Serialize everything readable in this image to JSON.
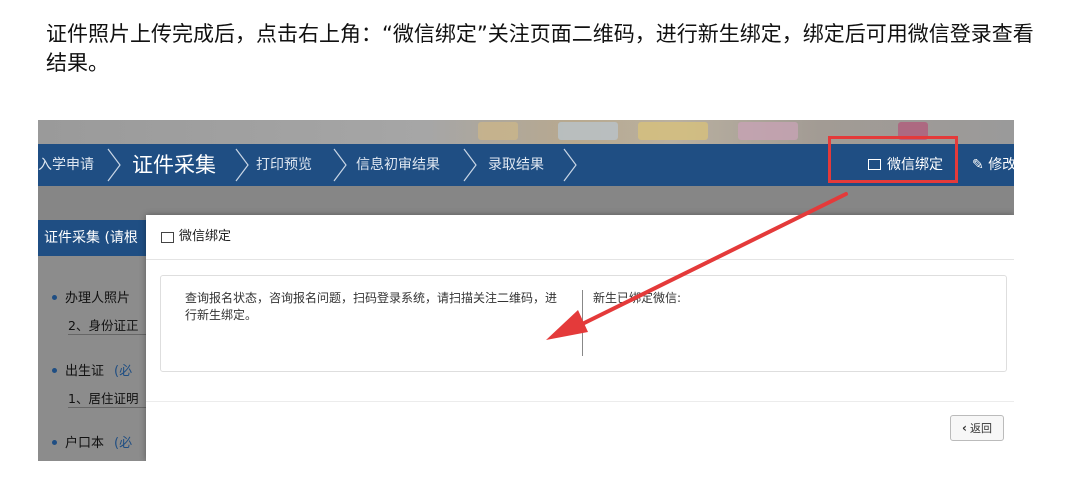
{
  "instruction": "证件照片上传完成后，点击右上角：“微信绑定”关注页面二维码，进行新生绑定，绑定后可用微信登录查看结果。",
  "nav": {
    "items": [
      "入学申请",
      "证件采集",
      "打印预览",
      "信息初审结果",
      "录取结果"
    ],
    "current_index": 1,
    "wechat_bind": "微信绑定",
    "modify": "修改"
  },
  "left_panel": {
    "title": "证件采集 (请根",
    "items": [
      {
        "label": "办理人照片",
        "sub": "2、身份证正"
      },
      {
        "label": "出生证",
        "required": "(必",
        "sub": "1、居住证明"
      },
      {
        "label": "户口本",
        "required": "(必"
      }
    ]
  },
  "modal": {
    "title": "微信绑定",
    "left_text": "查询报名状态，咨询报名问题，扫码登录系统，请扫描关注二维码，进行新生绑定。",
    "right_text": "新生已绑定微信:",
    "back_button": "返回"
  },
  "colors": {
    "nav_bg": "#1f4e83",
    "highlight": "#e43a3a"
  }
}
